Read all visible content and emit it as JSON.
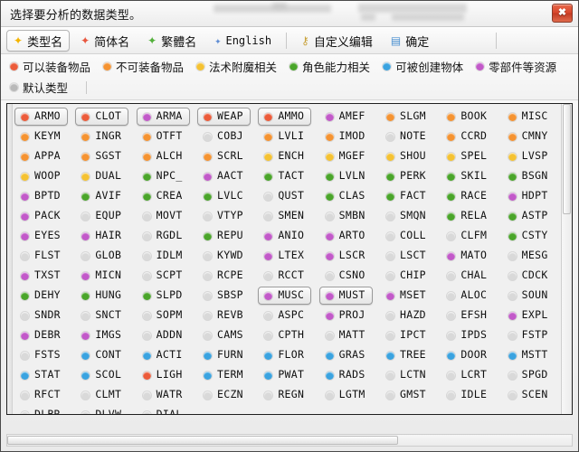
{
  "window": {
    "title": "选择要分析的数据类型。",
    "close_label": "✖"
  },
  "toolbar": {
    "items": [
      {
        "label": "类型名",
        "icon": "star-icon-gold",
        "star_class": "s-gold",
        "active": true,
        "mono": false
      },
      {
        "label": "简体名",
        "icon": "star-icon-red",
        "star_class": "s-red",
        "active": false,
        "mono": false
      },
      {
        "label": "繁體名",
        "icon": "star-icon-green",
        "star_class": "s-green",
        "active": false,
        "mono": false
      },
      {
        "label": "English",
        "icon": "star-icon-blue",
        "star_class": "s-blue",
        "active": false,
        "mono": true
      }
    ],
    "actions": [
      {
        "label": "自定义编辑",
        "icon": "key-icon"
      },
      {
        "label": "确定",
        "icon": "save-icon"
      }
    ]
  },
  "legend": {
    "row1": [
      {
        "label": "可以装备物品",
        "color": "#ec5b3a"
      },
      {
        "label": "不可装备物品",
        "color": "#f59331"
      },
      {
        "label": "法术附魔相关",
        "color": "#f5c232"
      },
      {
        "label": "角色能力相关",
        "color": "#4aa52a"
      },
      {
        "label": "可被创建物体",
        "color": "#3aa3e0"
      },
      {
        "label": "零部件等资源",
        "color": "#c259c9"
      }
    ],
    "row2": [
      {
        "label": "默认类型",
        "color": "#b9b9b9"
      }
    ]
  },
  "colors": {
    "equip": "#ec5b3a",
    "nonequip": "#f59331",
    "spell": "#f5c232",
    "ability": "#4aa52a",
    "creatable": "#3aa3e0",
    "resource": "#c259c9",
    "default": "#d9d9d9"
  },
  "grid": {
    "columns": 9,
    "cells": [
      {
        "label": "ARMO",
        "color": "#ec5b3a",
        "selected": true
      },
      {
        "label": "CLOT",
        "color": "#ec5b3a",
        "selected": true
      },
      {
        "label": "ARMA",
        "color": "#c259c9",
        "selected": true
      },
      {
        "label": "WEAP",
        "color": "#ec5b3a",
        "selected": true
      },
      {
        "label": "AMMO",
        "color": "#ec5b3a",
        "selected": true
      },
      {
        "label": "AMEF",
        "color": "#c259c9",
        "selected": false
      },
      {
        "label": "SLGM",
        "color": "#f59331",
        "selected": false
      },
      {
        "label": "BOOK",
        "color": "#f59331",
        "selected": false
      },
      {
        "label": "MISC",
        "color": "#f59331",
        "selected": false
      },
      {
        "label": "KEYM",
        "color": "#f59331",
        "selected": false
      },
      {
        "label": "INGR",
        "color": "#f59331",
        "selected": false
      },
      {
        "label": "OTFT",
        "color": "#f59331",
        "selected": false
      },
      {
        "label": "COBJ",
        "color": "#d9d9d9",
        "selected": false
      },
      {
        "label": "LVLI",
        "color": "#f59331",
        "selected": false
      },
      {
        "label": "IMOD",
        "color": "#f59331",
        "selected": false
      },
      {
        "label": "NOTE",
        "color": "#d9d9d9",
        "selected": false
      },
      {
        "label": "CCRD",
        "color": "#f59331",
        "selected": false
      },
      {
        "label": "CMNY",
        "color": "#f59331",
        "selected": false
      },
      {
        "label": "APPA",
        "color": "#f59331",
        "selected": false
      },
      {
        "label": "SGST",
        "color": "#f59331",
        "selected": false
      },
      {
        "label": "ALCH",
        "color": "#f59331",
        "selected": false
      },
      {
        "label": "SCRL",
        "color": "#f59331",
        "selected": false
      },
      {
        "label": "ENCH",
        "color": "#f5c232",
        "selected": false
      },
      {
        "label": "MGEF",
        "color": "#f5c232",
        "selected": false
      },
      {
        "label": "SHOU",
        "color": "#f5c232",
        "selected": false
      },
      {
        "label": "SPEL",
        "color": "#f5c232",
        "selected": false
      },
      {
        "label": "LVSP",
        "color": "#f5c232",
        "selected": false
      },
      {
        "label": "WOOP",
        "color": "#f5c232",
        "selected": false
      },
      {
        "label": "DUAL",
        "color": "#f5c232",
        "selected": false
      },
      {
        "label": "NPC_",
        "color": "#4aa52a",
        "selected": false
      },
      {
        "label": "AACT",
        "color": "#c259c9",
        "selected": false
      },
      {
        "label": "TACT",
        "color": "#4aa52a",
        "selected": false
      },
      {
        "label": "LVLN",
        "color": "#4aa52a",
        "selected": false
      },
      {
        "label": "PERK",
        "color": "#4aa52a",
        "selected": false
      },
      {
        "label": "SKIL",
        "color": "#4aa52a",
        "selected": false
      },
      {
        "label": "BSGN",
        "color": "#4aa52a",
        "selected": false
      },
      {
        "label": "BPTD",
        "color": "#c259c9",
        "selected": false
      },
      {
        "label": "AVIF",
        "color": "#4aa52a",
        "selected": false
      },
      {
        "label": "CREA",
        "color": "#4aa52a",
        "selected": false
      },
      {
        "label": "LVLC",
        "color": "#4aa52a",
        "selected": false
      },
      {
        "label": "QUST",
        "color": "#d9d9d9",
        "selected": false
      },
      {
        "label": "CLAS",
        "color": "#4aa52a",
        "selected": false
      },
      {
        "label": "FACT",
        "color": "#4aa52a",
        "selected": false
      },
      {
        "label": "RACE",
        "color": "#4aa52a",
        "selected": false
      },
      {
        "label": "HDPT",
        "color": "#c259c9",
        "selected": false
      },
      {
        "label": "PACK",
        "color": "#c259c9",
        "selected": false
      },
      {
        "label": "EQUP",
        "color": "#d9d9d9",
        "selected": false
      },
      {
        "label": "MOVT",
        "color": "#d9d9d9",
        "selected": false
      },
      {
        "label": "VTYP",
        "color": "#d9d9d9",
        "selected": false
      },
      {
        "label": "SMEN",
        "color": "#d9d9d9",
        "selected": false
      },
      {
        "label": "SMBN",
        "color": "#d9d9d9",
        "selected": false
      },
      {
        "label": "SMQN",
        "color": "#d9d9d9",
        "selected": false
      },
      {
        "label": "RELA",
        "color": "#4aa52a",
        "selected": false
      },
      {
        "label": "ASTP",
        "color": "#4aa52a",
        "selected": false
      },
      {
        "label": "EYES",
        "color": "#c259c9",
        "selected": false
      },
      {
        "label": "HAIR",
        "color": "#c259c9",
        "selected": false
      },
      {
        "label": "RGDL",
        "color": "#d9d9d9",
        "selected": false
      },
      {
        "label": "REPU",
        "color": "#4aa52a",
        "selected": false
      },
      {
        "label": "ANIO",
        "color": "#c259c9",
        "selected": false
      },
      {
        "label": "ARTO",
        "color": "#c259c9",
        "selected": false
      },
      {
        "label": "COLL",
        "color": "#d9d9d9",
        "selected": false
      },
      {
        "label": "CLFM",
        "color": "#d9d9d9",
        "selected": false
      },
      {
        "label": "CSTY",
        "color": "#4aa52a",
        "selected": false
      },
      {
        "label": "FLST",
        "color": "#d9d9d9",
        "selected": false
      },
      {
        "label": "GLOB",
        "color": "#d9d9d9",
        "selected": false
      },
      {
        "label": "IDLM",
        "color": "#d9d9d9",
        "selected": false
      },
      {
        "label": "KYWD",
        "color": "#d9d9d9",
        "selected": false
      },
      {
        "label": "LTEX",
        "color": "#c259c9",
        "selected": false
      },
      {
        "label": "LSCR",
        "color": "#c259c9",
        "selected": false
      },
      {
        "label": "LSCT",
        "color": "#d9d9d9",
        "selected": false
      },
      {
        "label": "MATO",
        "color": "#c259c9",
        "selected": false
      },
      {
        "label": "MESG",
        "color": "#d9d9d9",
        "selected": false
      },
      {
        "label": "TXST",
        "color": "#c259c9",
        "selected": false
      },
      {
        "label": "MICN",
        "color": "#c259c9",
        "selected": false
      },
      {
        "label": "SCPT",
        "color": "#d9d9d9",
        "selected": false
      },
      {
        "label": "RCPE",
        "color": "#d9d9d9",
        "selected": false
      },
      {
        "label": "RCCT",
        "color": "#d9d9d9",
        "selected": false
      },
      {
        "label": "CSNO",
        "color": "#d9d9d9",
        "selected": false
      },
      {
        "label": "CHIP",
        "color": "#d9d9d9",
        "selected": false
      },
      {
        "label": "CHAL",
        "color": "#d9d9d9",
        "selected": false
      },
      {
        "label": "CDCK",
        "color": "#d9d9d9",
        "selected": false
      },
      {
        "label": "DEHY",
        "color": "#4aa52a",
        "selected": false
      },
      {
        "label": "HUNG",
        "color": "#4aa52a",
        "selected": false
      },
      {
        "label": "SLPD",
        "color": "#4aa52a",
        "selected": false
      },
      {
        "label": "SBSP",
        "color": "#d9d9d9",
        "selected": false
      },
      {
        "label": "MUSC",
        "color": "#c259c9",
        "selected": true
      },
      {
        "label": "MUST",
        "color": "#c259c9",
        "selected": true
      },
      {
        "label": "MSET",
        "color": "#c259c9",
        "selected": false
      },
      {
        "label": "ALOC",
        "color": "#d9d9d9",
        "selected": false
      },
      {
        "label": "SOUN",
        "color": "#d9d9d9",
        "selected": false
      },
      {
        "label": "SNDR",
        "color": "#d9d9d9",
        "selected": false
      },
      {
        "label": "SNCT",
        "color": "#d9d9d9",
        "selected": false
      },
      {
        "label": "SOPM",
        "color": "#d9d9d9",
        "selected": false
      },
      {
        "label": "REVB",
        "color": "#d9d9d9",
        "selected": false
      },
      {
        "label": "ASPC",
        "color": "#d9d9d9",
        "selected": false
      },
      {
        "label": "PROJ",
        "color": "#c259c9",
        "selected": false
      },
      {
        "label": "HAZD",
        "color": "#d9d9d9",
        "selected": false
      },
      {
        "label": "EFSH",
        "color": "#d9d9d9",
        "selected": false
      },
      {
        "label": "EXPL",
        "color": "#c259c9",
        "selected": false
      },
      {
        "label": "DEBR",
        "color": "#c259c9",
        "selected": false
      },
      {
        "label": "IMGS",
        "color": "#c259c9",
        "selected": false
      },
      {
        "label": "ADDN",
        "color": "#d9d9d9",
        "selected": false
      },
      {
        "label": "CAMS",
        "color": "#d9d9d9",
        "selected": false
      },
      {
        "label": "CPTH",
        "color": "#d9d9d9",
        "selected": false
      },
      {
        "label": "MATT",
        "color": "#d9d9d9",
        "selected": false
      },
      {
        "label": "IPCT",
        "color": "#d9d9d9",
        "selected": false
      },
      {
        "label": "IPDS",
        "color": "#d9d9d9",
        "selected": false
      },
      {
        "label": "FSTP",
        "color": "#d9d9d9",
        "selected": false
      },
      {
        "label": "FSTS",
        "color": "#d9d9d9",
        "selected": false
      },
      {
        "label": "CONT",
        "color": "#3aa3e0",
        "selected": false
      },
      {
        "label": "ACTI",
        "color": "#3aa3e0",
        "selected": false
      },
      {
        "label": "FURN",
        "color": "#3aa3e0",
        "selected": false
      },
      {
        "label": "FLOR",
        "color": "#3aa3e0",
        "selected": false
      },
      {
        "label": "GRAS",
        "color": "#3aa3e0",
        "selected": false
      },
      {
        "label": "TREE",
        "color": "#3aa3e0",
        "selected": false
      },
      {
        "label": "DOOR",
        "color": "#3aa3e0",
        "selected": false
      },
      {
        "label": "MSTT",
        "color": "#3aa3e0",
        "selected": false
      },
      {
        "label": "STAT",
        "color": "#3aa3e0",
        "selected": false
      },
      {
        "label": "SCOL",
        "color": "#3aa3e0",
        "selected": false
      },
      {
        "label": "LIGH",
        "color": "#ec5b3a",
        "selected": false
      },
      {
        "label": "TERM",
        "color": "#3aa3e0",
        "selected": false
      },
      {
        "label": "PWAT",
        "color": "#3aa3e0",
        "selected": false
      },
      {
        "label": "RADS",
        "color": "#3aa3e0",
        "selected": false
      },
      {
        "label": "LCTN",
        "color": "#d9d9d9",
        "selected": false
      },
      {
        "label": "LCRT",
        "color": "#d9d9d9",
        "selected": false
      },
      {
        "label": "SPGD",
        "color": "#d9d9d9",
        "selected": false
      },
      {
        "label": "RFCT",
        "color": "#d9d9d9",
        "selected": false
      },
      {
        "label": "CLMT",
        "color": "#d9d9d9",
        "selected": false
      },
      {
        "label": "WATR",
        "color": "#d9d9d9",
        "selected": false
      },
      {
        "label": "ECZN",
        "color": "#d9d9d9",
        "selected": false
      },
      {
        "label": "REGN",
        "color": "#d9d9d9",
        "selected": false
      },
      {
        "label": "LGTM",
        "color": "#d9d9d9",
        "selected": false
      },
      {
        "label": "GMST",
        "color": "#d9d9d9",
        "selected": false
      },
      {
        "label": "IDLE",
        "color": "#d9d9d9",
        "selected": false
      },
      {
        "label": "SCEN",
        "color": "#d9d9d9",
        "selected": false
      },
      {
        "label": "DLBR",
        "color": "#d9d9d9",
        "selected": false
      },
      {
        "label": "DLVW",
        "color": "#d9d9d9",
        "selected": false
      },
      {
        "label": "DIAL",
        "color": "#d9d9d9",
        "selected": false
      }
    ]
  }
}
